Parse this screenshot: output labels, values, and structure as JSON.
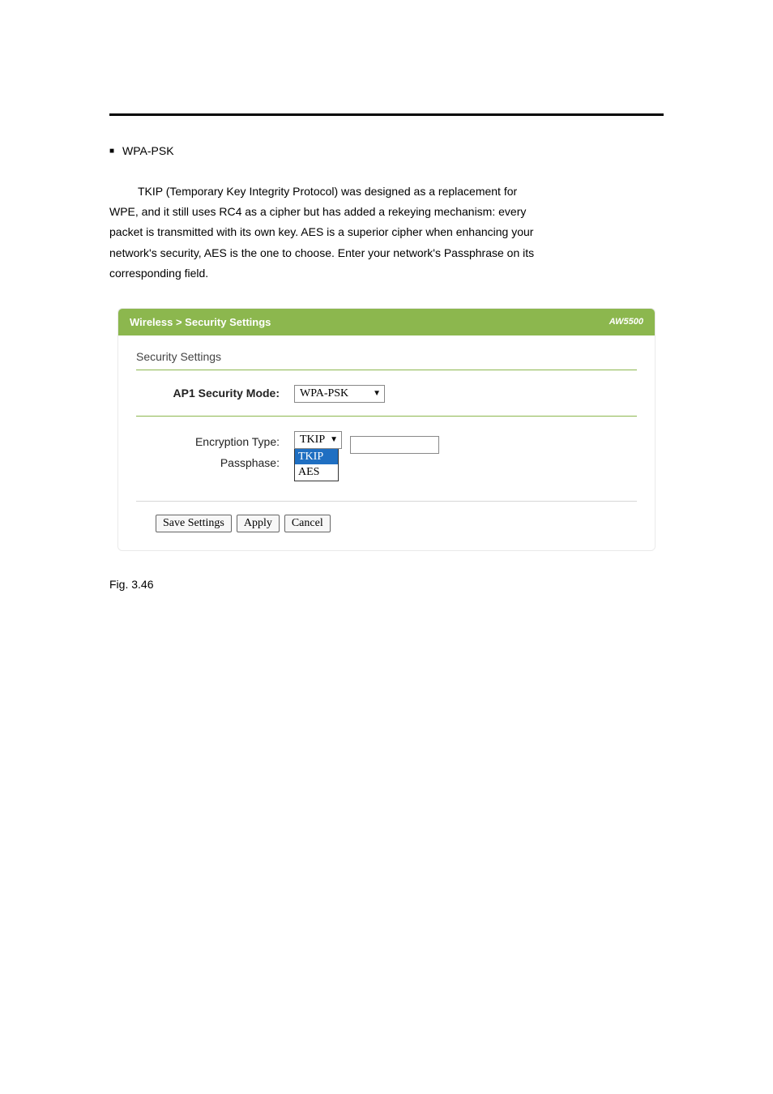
{
  "bullet": {
    "heading": "WPA-PSK"
  },
  "prose": {
    "p1": "TKIP (Temporary Key Integrity Protocol) was designed as a replacement for",
    "p2": "WPE, and it still uses RC4 as a cipher but has added a rekeying mechanism: every",
    "p3": "packet is transmitted with its own key. AES is a superior cipher when enhancing your",
    "p4": "network's security, AES is the one to choose. Enter your network's Passphrase on its",
    "p5": "corresponding field."
  },
  "panel": {
    "breadcrumb": "Wireless > Security Settings",
    "model": "AW5500",
    "fieldset_title": "Security Settings",
    "security_mode": {
      "label": "AP1 Security Mode:",
      "value": "WPA-PSK"
    },
    "encryption": {
      "label": "Encryption Type:",
      "value": "TKIP",
      "options": [
        "TKIP",
        "AES"
      ]
    },
    "passphrase": {
      "label": "Passphase:",
      "value": ""
    },
    "buttons": {
      "save": "Save Settings",
      "apply": "Apply",
      "cancel": "Cancel"
    }
  },
  "caption": "Fig. 3.46"
}
